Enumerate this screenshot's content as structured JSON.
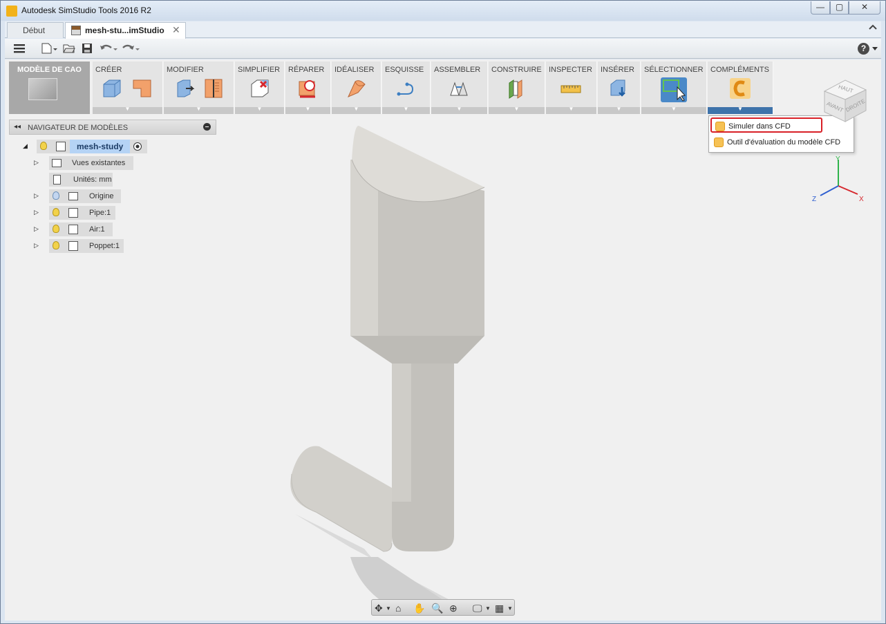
{
  "window": {
    "title": "Autodesk SimStudio Tools 2016 R2",
    "min_glyph": "—",
    "max_glyph": "▢",
    "close_glyph": "✕",
    "app_icon": "autodesk-logo-icon"
  },
  "tabs": [
    {
      "label": "Début",
      "active": false
    },
    {
      "label": "mesh-stu...imStudio",
      "active": true,
      "close_glyph": "✕"
    }
  ],
  "qat": {
    "menu_glyph": "≡",
    "new_glyph": "🗋",
    "open_glyph": "📂",
    "save_glyph": "💾",
    "undo_glyph": "↶",
    "redo_glyph": "↷",
    "help_glyph": "?"
  },
  "ribbon": {
    "workspace_label": "MODÈLE DE CAO",
    "groups": [
      {
        "id": "creer",
        "label": "CRÉER"
      },
      {
        "id": "modifier",
        "label": "MODIFIER"
      },
      {
        "id": "simplifier",
        "label": "SIMPLIFIER"
      },
      {
        "id": "reparer",
        "label": "RÉPARER"
      },
      {
        "id": "idealiser",
        "label": "IDÉALISER"
      },
      {
        "id": "esquisse",
        "label": "ESQUISSE"
      },
      {
        "id": "assembler",
        "label": "ASSEMBLER"
      },
      {
        "id": "construire",
        "label": "CONSTRUIRE"
      },
      {
        "id": "inspecter",
        "label": "INSPECTER"
      },
      {
        "id": "inserer",
        "label": "INSÉRER"
      },
      {
        "id": "selectionner",
        "label": "SÉLECTIONNER"
      },
      {
        "id": "complements",
        "label": "COMPLÉMENTS"
      }
    ],
    "dropdown_glyph": "▼"
  },
  "addins_menu": {
    "items": [
      {
        "label": "Simuler dans CFD",
        "highlighted": true
      },
      {
        "label": "Outil d'évaluation du modèle CFD",
        "highlighted": false
      }
    ]
  },
  "browser": {
    "title": "NAVIGATEUR DE MODÈLES",
    "collapse_glyph": "◂◂",
    "root": {
      "label": "mesh-study",
      "expand_glyph": "◢"
    },
    "items": [
      {
        "label": "Vues existantes",
        "expand_glyph": "▷",
        "icon": "folder-icon",
        "bulb": false
      },
      {
        "label": "Unités: mm",
        "expand_glyph": "",
        "icon": "document-icon",
        "bulb": false
      },
      {
        "label": "Origine",
        "expand_glyph": "▷",
        "icon": "folder-icon",
        "bulb": "off"
      },
      {
        "label": "Pipe:1",
        "expand_glyph": "▷",
        "icon": "body-icon",
        "bulb": "on"
      },
      {
        "label": "Air:1",
        "expand_glyph": "▷",
        "icon": "body-icon",
        "bulb": "on"
      },
      {
        "label": "Poppet:1",
        "expand_glyph": "▷",
        "icon": "body-icon",
        "bulb": "on"
      }
    ]
  },
  "viewcube": {
    "top": "HAUT",
    "front": "AVANT",
    "right": "DROITE"
  },
  "axes": {
    "x": "X",
    "y": "Y",
    "z": "Z"
  },
  "navbar": {
    "orbit_glyph": "✥",
    "look_glyph": "⌂",
    "pan_glyph": "✋",
    "zoom_glyph": "🔍",
    "fit_glyph": "⊕",
    "display_glyph": "🖵",
    "grid_glyph": "▦"
  },
  "colors": {
    "accent_blue": "#3e73aa",
    "highlight_red": "#d81f26",
    "model_gray": "#c7c5c0"
  }
}
